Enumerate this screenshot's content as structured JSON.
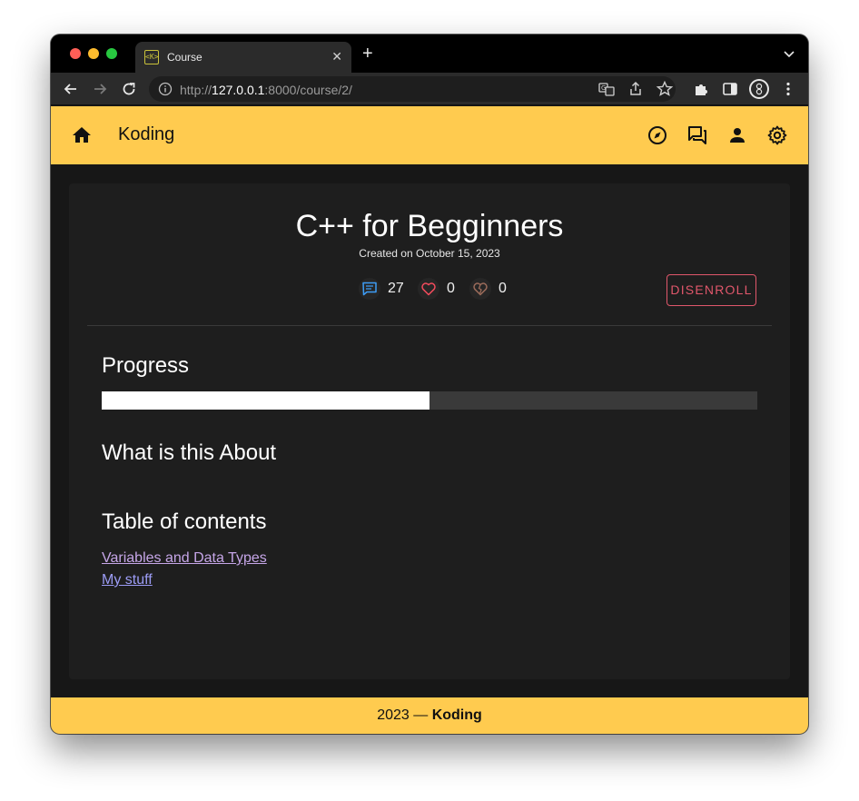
{
  "browser": {
    "tab_title": "Course",
    "tab_favicon_text": "<K>",
    "url_scheme": "http://",
    "url_host": "127.0.0.1",
    "url_rest": ":8000/course/2/"
  },
  "appbar": {
    "brand": "Koding",
    "color": "#ffcb4f"
  },
  "course": {
    "title": "C++ for Begginners",
    "created": "Created on October 15, 2023",
    "comments_count": "27",
    "likes_count": "0",
    "dislikes_count": "0",
    "disenroll_label": "DISENROLL",
    "accent_color": "#e0576b"
  },
  "progress": {
    "heading": "Progress",
    "fraction": 0.5
  },
  "about": {
    "heading": "What is this About"
  },
  "toc": {
    "heading": "Table of contents",
    "items": [
      {
        "label": "Variables and Data Types",
        "visited": true
      },
      {
        "label": "My stuff",
        "visited": false
      }
    ]
  },
  "footer": {
    "year": "2023 —",
    "brand": "Koding"
  }
}
